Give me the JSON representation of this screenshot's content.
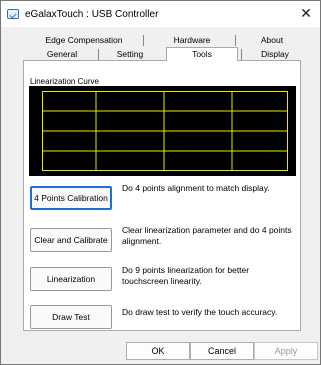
{
  "window": {
    "title": "eGalaxTouch : USB Controller"
  },
  "tabs": {
    "row1": [
      {
        "label": "Edge Compensation"
      },
      {
        "label": "Hardware"
      },
      {
        "label": "About"
      }
    ],
    "row2": [
      {
        "label": "General"
      },
      {
        "label": "Setting"
      },
      {
        "label": "Tools",
        "active": true
      },
      {
        "label": "Display"
      }
    ]
  },
  "tools": {
    "curve_label": "Linearization Curve",
    "grid_color": "#e8e800",
    "grid_rows": 4,
    "grid_cols": 4,
    "actions": [
      {
        "button": "4 Points Calibration",
        "description": "Do 4 points alignment to match display."
      },
      {
        "button": "Clear and Calibrate",
        "description": "Clear linearization parameter and do 4 points alignment."
      },
      {
        "button": "Linearization",
        "description": "Do 9 points linearization for better touchscreen linearity."
      },
      {
        "button": "Draw Test",
        "description": "Do draw test to verify the touch accuracy."
      }
    ]
  },
  "footer": {
    "ok": "OK",
    "cancel": "Cancel",
    "apply": "Apply"
  }
}
